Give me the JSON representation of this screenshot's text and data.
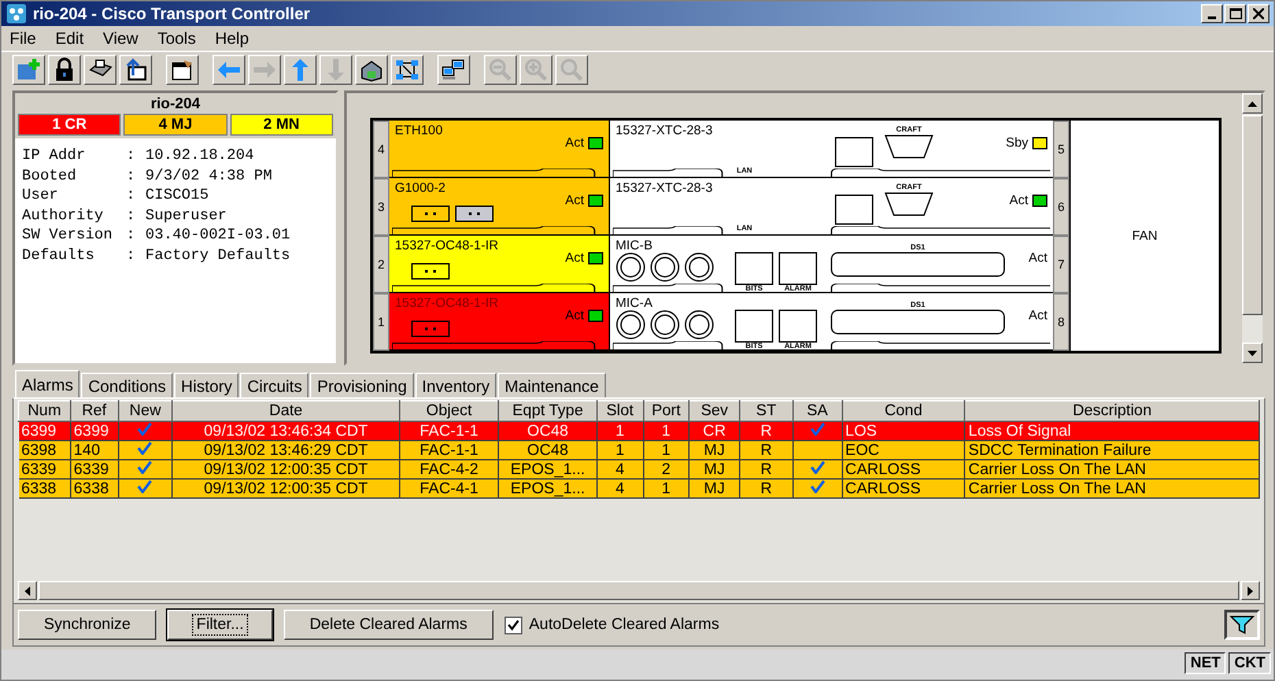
{
  "window": {
    "title": "rio-204 - Cisco Transport Controller"
  },
  "menu": [
    {
      "label": "File"
    },
    {
      "label": "Edit"
    },
    {
      "label": "View"
    },
    {
      "label": "Tools"
    },
    {
      "label": "Help"
    }
  ],
  "toolbar": [
    [
      {
        "kind": "add-node",
        "disabled": false
      },
      {
        "kind": "lock",
        "disabled": false
      },
      {
        "kind": "print",
        "disabled": false
      },
      {
        "kind": "export",
        "disabled": false
      }
    ],
    [
      {
        "kind": "properties",
        "disabled": false
      }
    ],
    [
      {
        "kind": "back",
        "disabled": false
      },
      {
        "kind": "forward",
        "disabled": true
      },
      {
        "kind": "up",
        "disabled": false
      },
      {
        "kind": "down",
        "disabled": true
      },
      {
        "kind": "home",
        "disabled": false
      },
      {
        "kind": "network",
        "disabled": false
      }
    ],
    [
      {
        "kind": "computers",
        "disabled": false
      }
    ],
    [
      {
        "kind": "zoom-out",
        "disabled": true
      },
      {
        "kind": "zoom-in",
        "disabled": true
      },
      {
        "kind": "zoom-select",
        "disabled": true
      }
    ]
  ],
  "node": {
    "name": "rio-204",
    "alarm_counts": [
      {
        "label": "1 CR",
        "color": "#ff0000"
      },
      {
        "label": "4 MJ",
        "color": "#ffc800"
      },
      {
        "label": "2 MN",
        "color": "#ffff00"
      }
    ],
    "info": [
      {
        "label": "IP Addr",
        "separator": ":",
        "value": "10.92.18.204"
      },
      {
        "label": "Booted",
        "separator": ":",
        "value": "9/3/02 4:38 PM"
      },
      {
        "label": "User",
        "separator": ":",
        "value": "CISCO15"
      },
      {
        "label": "Authority",
        "separator": ":",
        "value": "Superuser"
      },
      {
        "label": "SW Version",
        "separator": ":",
        "value": "03.40-002I-03.01"
      },
      {
        "label": "Defaults",
        "separator": ":",
        "value": "Factory Defaults"
      }
    ]
  },
  "shelf": {
    "left_cards": [
      {
        "slot": "4",
        "name": "ETH100",
        "status": "Act",
        "led": {
          "color": "#00d000"
        },
        "color": "#ffc800"
      },
      {
        "slot": "3",
        "name": "G1000-2",
        "status": "Act",
        "led": {
          "color": "#00d000"
        },
        "color": "#ffc800",
        "connectors": [
          {
            "installed": false
          },
          {
            "installed": true
          }
        ]
      },
      {
        "slot": "2",
        "name": "15327-OC48-1-IR",
        "status": "Act",
        "led": {
          "color": "#00d000"
        },
        "color": "#ffff00",
        "connectors": [
          {
            "installed": false
          }
        ]
      },
      {
        "slot": "1",
        "name": "15327-OC48-1-IR",
        "status": "Act",
        "led": {
          "color": "#00d000"
        },
        "color": "#ff0000",
        "connectors": [
          {
            "installed": false
          }
        ]
      }
    ],
    "right_cards": [
      {
        "slot": "5",
        "name": "15327-XTC-28-3",
        "status": "Sby",
        "led": {
          "color": "#ffee00"
        },
        "kind": "xtc",
        "port_labels": [
          "LAN",
          "CRAFT"
        ]
      },
      {
        "slot": "6",
        "name": "15327-XTC-28-3",
        "status": "Act",
        "led": {
          "color": "#00d000"
        },
        "kind": "xtc",
        "port_labels": [
          "LAN",
          "CRAFT"
        ]
      },
      {
        "slot": "7",
        "name": "MIC-B",
        "status": "Act",
        "kind": "mic",
        "port_labels": [
          "BITS",
          "ALARM",
          "DS1"
        ]
      },
      {
        "slot": "8",
        "name": "MIC-A",
        "status": "Act",
        "kind": "mic",
        "port_labels": [
          "BITS",
          "ALARM",
          "DS1"
        ]
      }
    ],
    "fan": {
      "label": "FAN"
    }
  },
  "tabs": [
    {
      "label": "Alarms",
      "selected": true
    },
    {
      "label": "Conditions",
      "selected": false
    },
    {
      "label": "History",
      "selected": false
    },
    {
      "label": "Circuits",
      "selected": false
    },
    {
      "label": "Provisioning",
      "selected": false
    },
    {
      "label": "Inventory",
      "selected": false
    },
    {
      "label": "Maintenance",
      "selected": false
    }
  ],
  "table": {
    "columns": [
      {
        "label": "Num",
        "kind": "text"
      },
      {
        "label": "Ref",
        "kind": "text"
      },
      {
        "label": "New",
        "kind": "check"
      },
      {
        "label": "Date",
        "kind": "text"
      },
      {
        "label": "Object",
        "kind": "text"
      },
      {
        "label": "Eqpt Type",
        "kind": "text"
      },
      {
        "label": "Slot",
        "kind": "text"
      },
      {
        "label": "Port",
        "kind": "text"
      },
      {
        "label": "Sev",
        "kind": "text"
      },
      {
        "label": "ST",
        "kind": "text"
      },
      {
        "label": "SA",
        "kind": "check"
      },
      {
        "label": "Cond",
        "kind": "text"
      },
      {
        "label": "Description",
        "kind": "text"
      }
    ],
    "rows": [
      {
        "color": "#ff0000",
        "cells": [
          "6399",
          "6399",
          true,
          "09/13/02 13:46:34 CDT",
          "FAC-1-1",
          "OC48",
          "1",
          "1",
          "CR",
          "R",
          true,
          "LOS",
          "Loss Of Signal"
        ]
      },
      {
        "color": "#ffc800",
        "cells": [
          "6398",
          "140",
          true,
          "09/13/02 13:46:29 CDT",
          "FAC-1-1",
          "OC48",
          "1",
          "1",
          "MJ",
          "R",
          false,
          "EOC",
          "SDCC Termination Failure"
        ]
      },
      {
        "color": "#ffc800",
        "cells": [
          "6339",
          "6339",
          true,
          "09/13/02 12:00:35 CDT",
          "FAC-4-2",
          "EPOS_1...",
          "4",
          "2",
          "MJ",
          "R",
          true,
          "CARLOSS",
          "Carrier Loss On The LAN"
        ]
      },
      {
        "color": "#ffc800",
        "cells": [
          "6338",
          "6338",
          true,
          "09/13/02 12:00:35 CDT",
          "FAC-4-1",
          "EPOS_1...",
          "4",
          "1",
          "MJ",
          "R",
          true,
          "CARLOSS",
          "Carrier Loss On The LAN"
        ]
      }
    ]
  },
  "buttons": [
    {
      "label": "Synchronize",
      "focused": false
    },
    {
      "label": "Filter...",
      "focused": true
    },
    {
      "label": "Delete Cleared Alarms",
      "focused": false
    }
  ],
  "auto_delete": {
    "label": "AutoDelete Cleared Alarms",
    "checked": true
  },
  "status_bar": [
    {
      "label": "NET"
    },
    {
      "label": "CKT"
    }
  ]
}
